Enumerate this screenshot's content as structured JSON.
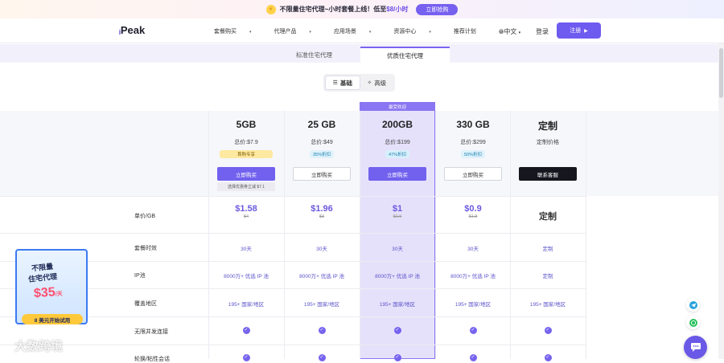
{
  "banner": {
    "text_a": "不限量住宅代理~小时套餐上线！低至",
    "price": "$8",
    "text_b": "/小时",
    "button": "立即抢购"
  },
  "nav": {
    "logo_text": "Peak",
    "menu": [
      "套餐购买",
      "代理产品",
      "应用场景",
      "资源中心",
      "推荐计划"
    ],
    "language": "中文",
    "login": "登录",
    "register": "注册"
  },
  "tabs": [
    "标准住宅代理",
    "优质住宅代理"
  ],
  "toggle": [
    "基础",
    "高级"
  ],
  "hot_label": "最受欢迎",
  "plans": [
    {
      "size": "5GB",
      "total": "总价:$7.9",
      "badge": "首购专享",
      "button": "立即购买",
      "note": "选择优惠券立减 $7.1",
      "unit_price": "$1.58",
      "orig_price": "$4",
      "duration": "30天",
      "ip_pool": "8000万+ 优选 IP 池",
      "regions": "195+ 国家/地区"
    },
    {
      "size": "25 GB",
      "total": "总价:$49",
      "badge": "35%折扣",
      "button": "立即购买",
      "unit_price": "$1.96",
      "orig_price": "$3",
      "duration": "30天",
      "ip_pool": "8000万+ 优选 IP 池",
      "regions": "195+ 国家/地区"
    },
    {
      "size": "200GB",
      "total": "总价:$199",
      "badge": "47%折扣",
      "button": "立即购买",
      "unit_price": "$1",
      "orig_price": "$1.9",
      "duration": "30天",
      "ip_pool": "8000万+ 优选 IP 池",
      "regions": "195+ 国家/地区"
    },
    {
      "size": "330 GB",
      "total": "总价:$299",
      "badge": "50%折扣",
      "button": "立即购买",
      "unit_price": "$0.9",
      "orig_price": "$1.8",
      "duration": "30天",
      "ip_pool": "8000万+ 优选 IP 池",
      "regions": "195+ 国家/地区"
    },
    {
      "size": "定制",
      "total": "定制价格",
      "button": "联系客服",
      "unit_price": "定制",
      "duration": "定制",
      "ip_pool": "定制",
      "regions": "195+ 国家/地区"
    }
  ],
  "row_labels": [
    "单价/GB",
    "套餐时效",
    "IP池",
    "覆盖地区",
    "无限并发连接",
    "轮换/粘性会话"
  ],
  "promo": {
    "line1": "不限量",
    "line2": "住宅代理",
    "price": "$35",
    "per": "/天",
    "cta": "8 美元开始试用"
  },
  "watermark": "大数跨境",
  "colors": {
    "accent": "#7161ee",
    "highlight_bg": "#e6e1fb",
    "price": "#6c5ae0"
  }
}
